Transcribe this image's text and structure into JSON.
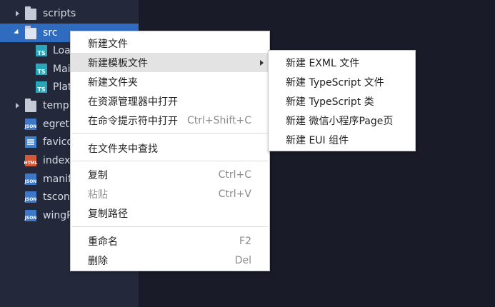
{
  "tree": {
    "items": [
      {
        "label": "scripts",
        "icon": "folder-icon"
      },
      {
        "label": "src",
        "icon": "folder-open-icon"
      },
      {
        "label": "Loa",
        "icon": "typescript-file-icon",
        "badge": "TS"
      },
      {
        "label": "Mai",
        "icon": "typescript-file-icon",
        "badge": "TS"
      },
      {
        "label": "Plat",
        "icon": "typescript-file-icon",
        "badge": "TS"
      },
      {
        "label": "templ",
        "icon": "folder-icon"
      },
      {
        "label": "egretl",
        "icon": "json-file-icon",
        "badge": "JSON"
      },
      {
        "label": "favico",
        "icon": "text-file-icon"
      },
      {
        "label": "index.",
        "icon": "html-file-icon",
        "badge": "HTML"
      },
      {
        "label": "manif",
        "icon": "json-file-icon",
        "badge": "JSON"
      },
      {
        "label": "tscont",
        "icon": "json-file-icon",
        "badge": "JSON"
      },
      {
        "label": "wingP",
        "icon": "json-file-icon",
        "badge": "JSON"
      }
    ]
  },
  "context_menu": {
    "items": [
      {
        "label": "新建文件",
        "shortcut": ""
      },
      {
        "label": "新建模板文件",
        "shortcut": ""
      },
      {
        "label": "新建文件夹",
        "shortcut": ""
      },
      {
        "label": "在资源管理器中打开",
        "shortcut": ""
      },
      {
        "label": "在命令提示符中打开",
        "shortcut": "Ctrl+Shift+C"
      },
      {
        "label": "在文件夹中查找",
        "shortcut": ""
      },
      {
        "label": "复制",
        "shortcut": "Ctrl+C"
      },
      {
        "label": "粘贴",
        "shortcut": "Ctrl+V"
      },
      {
        "label": "复制路径",
        "shortcut": ""
      },
      {
        "label": "重命名",
        "shortcut": "F2"
      },
      {
        "label": "删除",
        "shortcut": "Del"
      }
    ]
  },
  "submenu": {
    "items": [
      {
        "label": "新建 EXML 文件"
      },
      {
        "label": "新建 TypeScript 文件"
      },
      {
        "label": "新建 TypeScript 类"
      },
      {
        "label": "新建 微信小程序Page页"
      },
      {
        "label": "新建 EUI 组件"
      }
    ]
  },
  "colors": {
    "sidebar_bg": "#24283b",
    "editor_bg": "#191b28",
    "selection": "#2f6bbf",
    "menu_bg": "#ffffff",
    "menu_hover": "#e3e3e3"
  }
}
